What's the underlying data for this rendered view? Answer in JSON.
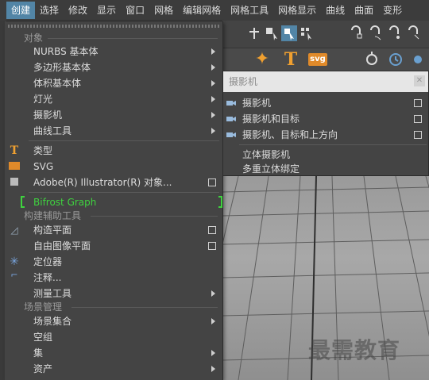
{
  "menubar": {
    "items": [
      "创建",
      "选择",
      "修改",
      "显示",
      "窗口",
      "网格",
      "编辑网格",
      "网格工具",
      "网格显示",
      "曲线",
      "曲面",
      "变形"
    ]
  },
  "create_menu": {
    "sections": {
      "objects": "对象",
      "construction_aids": "构建辅助工具",
      "scene_management": "场景管理"
    },
    "items": {
      "nurbs": "NURBS 基本体",
      "polygon": "多边形基本体",
      "volume": "体积基本体",
      "lights": "灯光",
      "cameras": "摄影机",
      "curve_tools": "曲线工具",
      "type": "类型",
      "svg": "SVG",
      "illustrator": "Adobe(R) Illustrator(R) 对象...",
      "bifrost": "Bifrost Graph",
      "construction_plane": "构造平面",
      "free_image_plane": "自由图像平面",
      "locator": "定位器",
      "annotation": "注释...",
      "measure_tools": "测量工具",
      "scene_assembly": "场景集合",
      "empty_group": "空组",
      "sets": "集",
      "assets": "资产"
    }
  },
  "camera_menu": {
    "title": "摄影机",
    "items": [
      "摄影机",
      "摄影机和目标",
      "摄影机、目标和上方向",
      "立体摄影机",
      "多重立体绑定"
    ]
  },
  "shelf": {
    "svg_label": "svg",
    "type_label": "T"
  },
  "watermark": "最需教育",
  "colors": {
    "menu_bg": "#444444",
    "highlight": "#5285a6",
    "bifrost_green": "#3fd33f"
  }
}
